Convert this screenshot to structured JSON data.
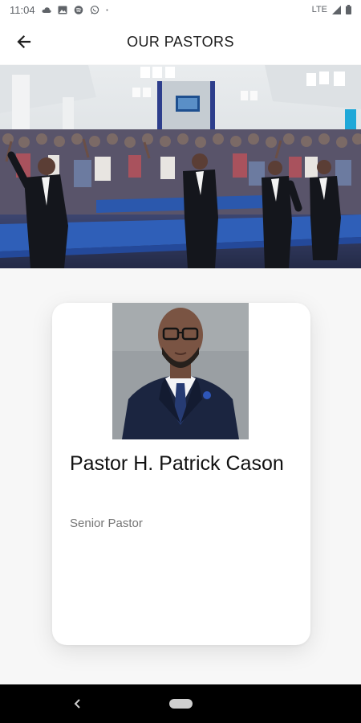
{
  "status_bar": {
    "time": "11:04",
    "network": "LTE",
    "left_icons": [
      "cloud-icon",
      "image-icon",
      "spotify-icon",
      "whatsapp-icon",
      "dot-icon"
    ],
    "right_icons": [
      "signal-icon",
      "battery-icon"
    ]
  },
  "app_bar": {
    "title": "OUR PASTORS",
    "back_icon": "arrow-left-icon"
  },
  "hero": {
    "description_icon": "church-congregation-photo"
  },
  "pastor": {
    "name": "Pastor H. Patrick Cason",
    "role": "Senior Pastor"
  },
  "nav_bar": {
    "back_icon": "chevron-left-icon",
    "home_icon": "home-pill-icon"
  }
}
